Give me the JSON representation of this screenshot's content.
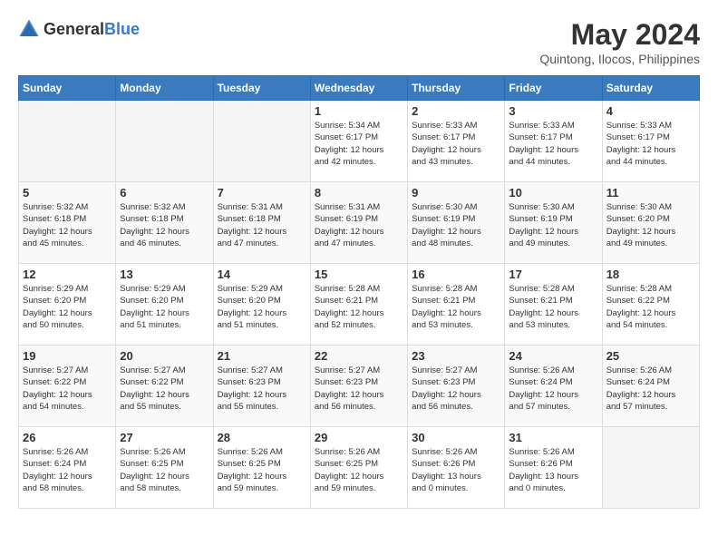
{
  "header": {
    "logo_general": "General",
    "logo_blue": "Blue",
    "month_year": "May 2024",
    "location": "Quintong, Ilocos, Philippines"
  },
  "days_of_week": [
    "Sunday",
    "Monday",
    "Tuesday",
    "Wednesday",
    "Thursday",
    "Friday",
    "Saturday"
  ],
  "weeks": [
    [
      {
        "num": "",
        "info": ""
      },
      {
        "num": "",
        "info": ""
      },
      {
        "num": "",
        "info": ""
      },
      {
        "num": "1",
        "info": "Sunrise: 5:34 AM\nSunset: 6:17 PM\nDaylight: 12 hours\nand 42 minutes."
      },
      {
        "num": "2",
        "info": "Sunrise: 5:33 AM\nSunset: 6:17 PM\nDaylight: 12 hours\nand 43 minutes."
      },
      {
        "num": "3",
        "info": "Sunrise: 5:33 AM\nSunset: 6:17 PM\nDaylight: 12 hours\nand 44 minutes."
      },
      {
        "num": "4",
        "info": "Sunrise: 5:33 AM\nSunset: 6:17 PM\nDaylight: 12 hours\nand 44 minutes."
      }
    ],
    [
      {
        "num": "5",
        "info": "Sunrise: 5:32 AM\nSunset: 6:18 PM\nDaylight: 12 hours\nand 45 minutes."
      },
      {
        "num": "6",
        "info": "Sunrise: 5:32 AM\nSunset: 6:18 PM\nDaylight: 12 hours\nand 46 minutes."
      },
      {
        "num": "7",
        "info": "Sunrise: 5:31 AM\nSunset: 6:18 PM\nDaylight: 12 hours\nand 47 minutes."
      },
      {
        "num": "8",
        "info": "Sunrise: 5:31 AM\nSunset: 6:19 PM\nDaylight: 12 hours\nand 47 minutes."
      },
      {
        "num": "9",
        "info": "Sunrise: 5:30 AM\nSunset: 6:19 PM\nDaylight: 12 hours\nand 48 minutes."
      },
      {
        "num": "10",
        "info": "Sunrise: 5:30 AM\nSunset: 6:19 PM\nDaylight: 12 hours\nand 49 minutes."
      },
      {
        "num": "11",
        "info": "Sunrise: 5:30 AM\nSunset: 6:20 PM\nDaylight: 12 hours\nand 49 minutes."
      }
    ],
    [
      {
        "num": "12",
        "info": "Sunrise: 5:29 AM\nSunset: 6:20 PM\nDaylight: 12 hours\nand 50 minutes."
      },
      {
        "num": "13",
        "info": "Sunrise: 5:29 AM\nSunset: 6:20 PM\nDaylight: 12 hours\nand 51 minutes."
      },
      {
        "num": "14",
        "info": "Sunrise: 5:29 AM\nSunset: 6:20 PM\nDaylight: 12 hours\nand 51 minutes."
      },
      {
        "num": "15",
        "info": "Sunrise: 5:28 AM\nSunset: 6:21 PM\nDaylight: 12 hours\nand 52 minutes."
      },
      {
        "num": "16",
        "info": "Sunrise: 5:28 AM\nSunset: 6:21 PM\nDaylight: 12 hours\nand 53 minutes."
      },
      {
        "num": "17",
        "info": "Sunrise: 5:28 AM\nSunset: 6:21 PM\nDaylight: 12 hours\nand 53 minutes."
      },
      {
        "num": "18",
        "info": "Sunrise: 5:28 AM\nSunset: 6:22 PM\nDaylight: 12 hours\nand 54 minutes."
      }
    ],
    [
      {
        "num": "19",
        "info": "Sunrise: 5:27 AM\nSunset: 6:22 PM\nDaylight: 12 hours\nand 54 minutes."
      },
      {
        "num": "20",
        "info": "Sunrise: 5:27 AM\nSunset: 6:22 PM\nDaylight: 12 hours\nand 55 minutes."
      },
      {
        "num": "21",
        "info": "Sunrise: 5:27 AM\nSunset: 6:23 PM\nDaylight: 12 hours\nand 55 minutes."
      },
      {
        "num": "22",
        "info": "Sunrise: 5:27 AM\nSunset: 6:23 PM\nDaylight: 12 hours\nand 56 minutes."
      },
      {
        "num": "23",
        "info": "Sunrise: 5:27 AM\nSunset: 6:23 PM\nDaylight: 12 hours\nand 56 minutes."
      },
      {
        "num": "24",
        "info": "Sunrise: 5:26 AM\nSunset: 6:24 PM\nDaylight: 12 hours\nand 57 minutes."
      },
      {
        "num": "25",
        "info": "Sunrise: 5:26 AM\nSunset: 6:24 PM\nDaylight: 12 hours\nand 57 minutes."
      }
    ],
    [
      {
        "num": "26",
        "info": "Sunrise: 5:26 AM\nSunset: 6:24 PM\nDaylight: 12 hours\nand 58 minutes."
      },
      {
        "num": "27",
        "info": "Sunrise: 5:26 AM\nSunset: 6:25 PM\nDaylight: 12 hours\nand 58 minutes."
      },
      {
        "num": "28",
        "info": "Sunrise: 5:26 AM\nSunset: 6:25 PM\nDaylight: 12 hours\nand 59 minutes."
      },
      {
        "num": "29",
        "info": "Sunrise: 5:26 AM\nSunset: 6:25 PM\nDaylight: 12 hours\nand 59 minutes."
      },
      {
        "num": "30",
        "info": "Sunrise: 5:26 AM\nSunset: 6:26 PM\nDaylight: 13 hours\nand 0 minutes."
      },
      {
        "num": "31",
        "info": "Sunrise: 5:26 AM\nSunset: 6:26 PM\nDaylight: 13 hours\nand 0 minutes."
      },
      {
        "num": "",
        "info": ""
      }
    ]
  ]
}
